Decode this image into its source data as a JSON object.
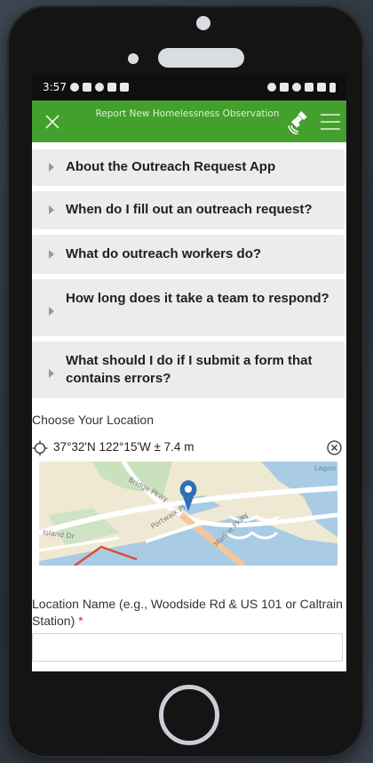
{
  "status_bar": {
    "time": "3:57"
  },
  "app_bar": {
    "title": "Report New Homelessness Observation",
    "close_icon": "close-icon",
    "gps_icon": "satellite-icon",
    "menu_icon": "hamburger-menu-icon"
  },
  "faq": [
    {
      "label": "About the Outreach Request App"
    },
    {
      "label": "When do I fill out an outreach request?"
    },
    {
      "label": "What do outreach workers do?"
    },
    {
      "label": "How long does it take a team to respond?"
    },
    {
      "label": "What should I do if I submit a form that contains errors?"
    }
  ],
  "location": {
    "section_label": "Choose Your Location",
    "coordinates": "37°32'N 122°15'W ± 7.4 m",
    "map_labels": {
      "bridge": "Bridge Pkwy",
      "portwalk": "Portwalk Pl",
      "marine": "Marine Pkwy",
      "island": "Island Dr",
      "lagoon": "Lagoo"
    }
  },
  "location_name": {
    "label": "Location Name (e.g., Woodside Rd & US 101 or Caltrain Station)",
    "required_marker": "*",
    "value": ""
  },
  "colors": {
    "app_bar": "#43a02c",
    "map_pin": "#2f6fb6",
    "required": "#d12a1f"
  }
}
